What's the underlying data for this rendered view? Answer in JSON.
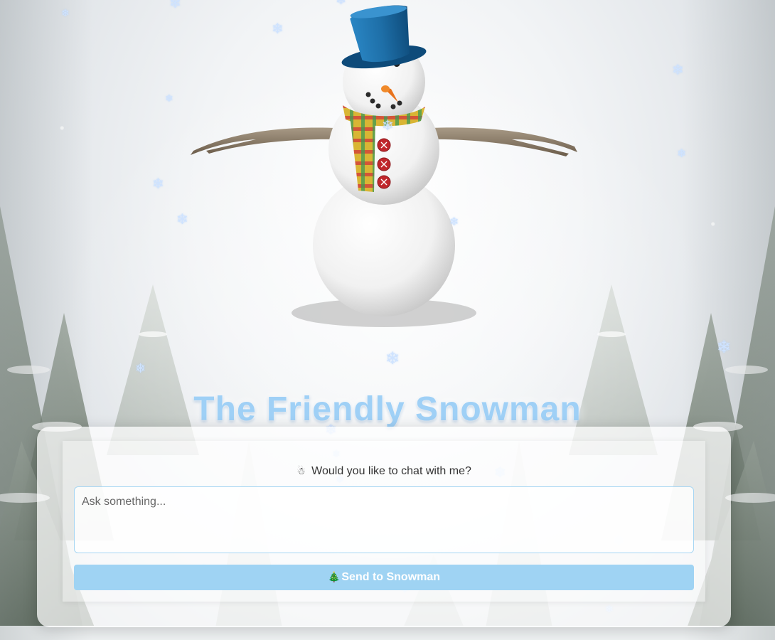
{
  "title": "The Friendly Snowman",
  "chat": {
    "prompt_icon": "snowman-emoji",
    "prompt_text": "Would you like to chat with me?",
    "input_placeholder": "Ask something...",
    "input_value": "",
    "send_icon": "christmas-tree-emoji",
    "send_label": "Send to Snowman"
  },
  "colors": {
    "title": "#9fd0f6",
    "button": "#9fd3f3",
    "input_border": "#a6d6f3",
    "snowflake": "#cfe3ff",
    "hat": "#1e6fa8",
    "scarf": "#c9a227",
    "buttons_red": "#c0262b"
  },
  "decor": {
    "snowflake_glyph": "❄"
  }
}
